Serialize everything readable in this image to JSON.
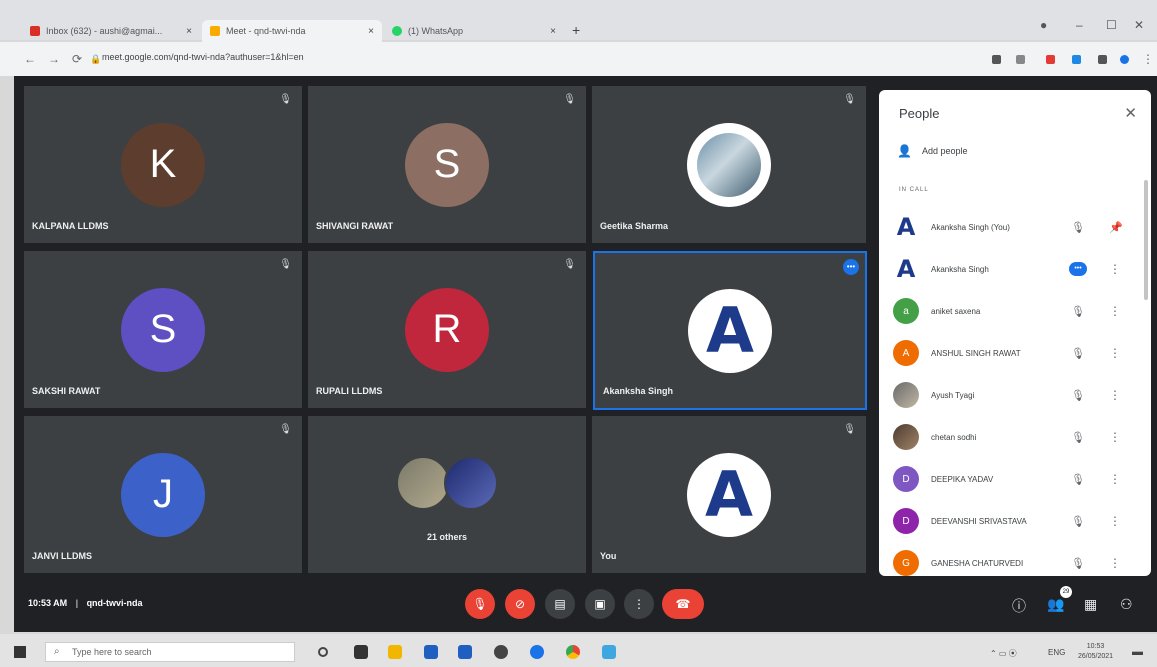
{
  "browser": {
    "tabs": [
      {
        "label": "Inbox (632) - aushi@agmai...",
        "color": "#d93025"
      },
      {
        "label": "Meet - qnd-twvi-nda",
        "color": "#f9ab00"
      },
      {
        "label": "(1) WhatsApp",
        "color": "#25d366"
      }
    ],
    "new_tab": "+",
    "url": "meet.google.com/qnd-twvi-nda?authuser=1&hl=en"
  },
  "tiles": [
    {
      "name": "KALPANA LLDMS",
      "initial": "K",
      "color": "#5d3d2e"
    },
    {
      "name": "SHIVANGI RAWAT",
      "initial": "S",
      "color": "#8d6e63"
    },
    {
      "name": "Geetika Sharma",
      "initial": "",
      "color": ""
    },
    {
      "name": "SAKSHI RAWAT",
      "initial": "S",
      "color": "#5e4fc2"
    },
    {
      "name": "RUPALI LLDMS",
      "initial": "R",
      "color": "#c0273c"
    },
    {
      "name": "Akanksha Singh",
      "initial": "A",
      "color": "#ffffff"
    },
    {
      "name": "JANVI LLDMS",
      "initial": "J",
      "color": "#3c62c9"
    },
    {
      "name": "21 others",
      "initial": "",
      "color": ""
    },
    {
      "name": "You",
      "initial": "A",
      "color": "#ffffff"
    }
  ],
  "panel": {
    "title": "People",
    "add_people": "Add people",
    "in_call": "IN CALL",
    "people": [
      {
        "name": "Akanksha Singh (You)",
        "initial": "A",
        "color": "#ffffff"
      },
      {
        "name": "Akanksha Singh",
        "initial": "A",
        "color": "#ffffff"
      },
      {
        "name": "aniket saxena",
        "initial": "a",
        "color": "#43a047"
      },
      {
        "name": "ANSHUL SINGH RAWAT",
        "initial": "A",
        "color": "#ef6c00"
      },
      {
        "name": "Ayush Tyagi",
        "initial": "",
        "color": ""
      },
      {
        "name": "chetan sodhi",
        "initial": "",
        "color": ""
      },
      {
        "name": "DEEPIKA YADAV",
        "initial": "D",
        "color": "#7e57c2"
      },
      {
        "name": "DEEVANSHI SRIVASTAVA",
        "initial": "D",
        "color": "#8e24aa"
      },
      {
        "name": "GANESHA CHATURVEDI",
        "initial": "G",
        "color": "#ef6c00"
      }
    ]
  },
  "bottom": {
    "time": "10:53 AM",
    "separator": "|",
    "meeting_code": "qnd-twvi-nda",
    "people_count": "29"
  },
  "taskbar": {
    "search_placeholder": "Type here to search",
    "lang": "ENG",
    "time": "10:53",
    "date": "26/05/2021"
  }
}
